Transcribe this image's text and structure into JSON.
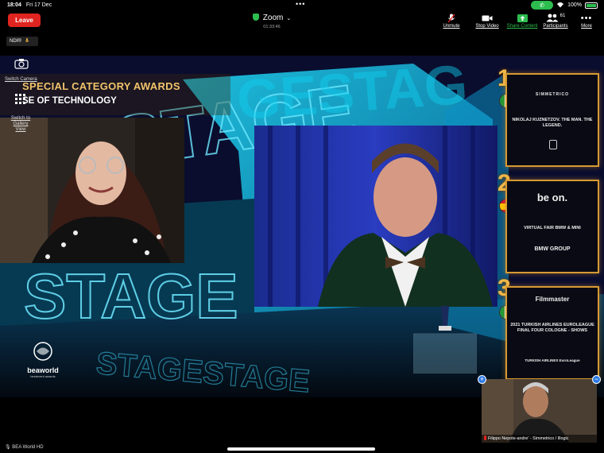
{
  "status_bar": {
    "time": "18:04",
    "date": "Fri 17 Dec",
    "battery": "100%"
  },
  "meeting": {
    "app_title": "Zoom",
    "timer": "01:33:46",
    "leave_label": "Leave"
  },
  "toolbar": {
    "unmute_label": "Unmute",
    "stop_video_label": "Stop Video",
    "share_content_label": "Share Content",
    "participants_label": "Participants",
    "participants_count": "61",
    "more_label": "More"
  },
  "ndi_badge": "NDI®",
  "side_controls": {
    "switch_camera_label": "Switch Camera",
    "switch_gallery_label": "Switch to Gallery View"
  },
  "banner": {
    "line1": "SPECIAL CATEGORY AWARDS",
    "line2": "SE OF TECHNOLOGY"
  },
  "awards": [
    {
      "rank": "1",
      "country": "Italy",
      "brand": "SIMMETRICO",
      "text": "NIKOLAJ KUZNETZOV. THE MAN. THE LEGEND."
    },
    {
      "rank": "2",
      "country": "Spain",
      "brand": "be on.",
      "text": "VIRTUAL FAIR BMW & MINI",
      "sub": "BMW GROUP"
    },
    {
      "rank": "3",
      "country": "Italy",
      "brand": "Filmmaster",
      "text": "2021 TURKISH AIRLINES EUROLEAGUE FINAL FOUR COLOGNE - SHOWS",
      "sub": "TURKISH AIRLINES EuroLeague"
    }
  ],
  "logo": {
    "bea_text": "beaworld",
    "bea_sub": "bestevent awards"
  },
  "self_view": {
    "name": "Filippo Nepote-andre' - Simmetrico / Illogic"
  },
  "bottom_label": "BEA World HD",
  "colors": {
    "leave": "#e0241f",
    "share_green": "#2dbd4f",
    "gold": "#d69a33",
    "neon": "#35c6e8"
  }
}
